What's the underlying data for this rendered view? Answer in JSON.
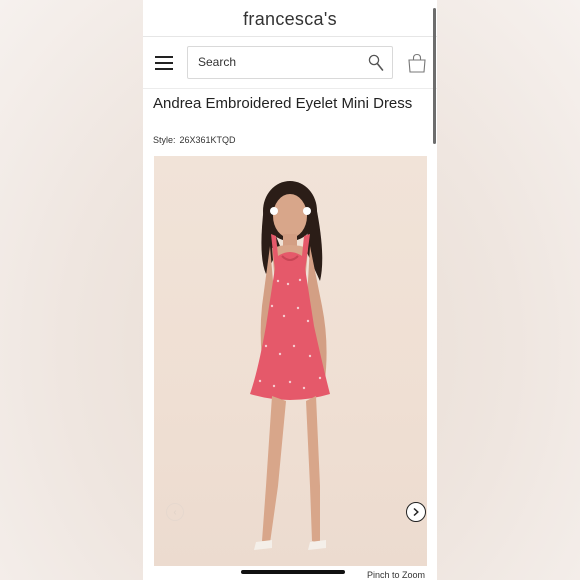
{
  "header": {
    "logo_text": "francesca's"
  },
  "nav": {
    "menu_icon": "hamburger-icon",
    "search_placeholder": "Search",
    "search_icon": "magnifier-icon",
    "bag_icon": "shopping-bag-icon"
  },
  "product": {
    "title": "Andrea Embroidered Eyelet Mini Dress",
    "style_label": "Style:",
    "style_code": "26X361KTQD",
    "image_alt": "Model wearing pink embroidered eyelet mini dress",
    "dress_color": "#e5596a"
  },
  "gallery": {
    "prev_icon": "chevron-left-icon",
    "next_icon": "chevron-right-icon",
    "zoom_hint": "Pinch to Zoom"
  }
}
